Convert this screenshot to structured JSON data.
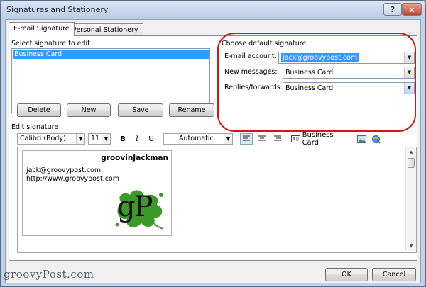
{
  "window": {
    "title": "Signatures and Stationery",
    "help_button": "?",
    "close_button": "x"
  },
  "tabs": [
    {
      "label": "E-mail Signature",
      "active": true
    },
    {
      "label": "Personal Stationery",
      "active": false
    }
  ],
  "select_signature": {
    "label": "Select signature to edit",
    "items": [
      "Business Card"
    ],
    "selected": "Business Card"
  },
  "signature_buttons": {
    "delete": "Delete",
    "new": "New",
    "save": "Save",
    "rename": "Rename"
  },
  "default_signature": {
    "group_label": "Choose default signature",
    "email_account_label": "E-mail account:",
    "email_account_value": "jack@groovypost.com",
    "new_messages_label": "New messages:",
    "new_messages_value": "Business Card",
    "replies_label": "Replies/forwards:",
    "replies_value": "Business Card"
  },
  "edit_signature": {
    "label": "Edit signature",
    "font": "Calibri (Body)",
    "size": "11",
    "bold": "B",
    "italic": "I",
    "underline": "U",
    "color": "Automatic",
    "business_card_button": "Business Card"
  },
  "signature_content": {
    "name": "groovinJackman",
    "email": "jack@groovypost.com",
    "website": "http://www.groovypost.com",
    "logo_text": "gP"
  },
  "footer": {
    "ok": "OK",
    "cancel": "Cancel",
    "watermark": "groovyPost.com"
  },
  "colors": {
    "selection": "#3399ff",
    "highlight_ring": "#d01818",
    "logo_green": "#3d9a2a"
  }
}
